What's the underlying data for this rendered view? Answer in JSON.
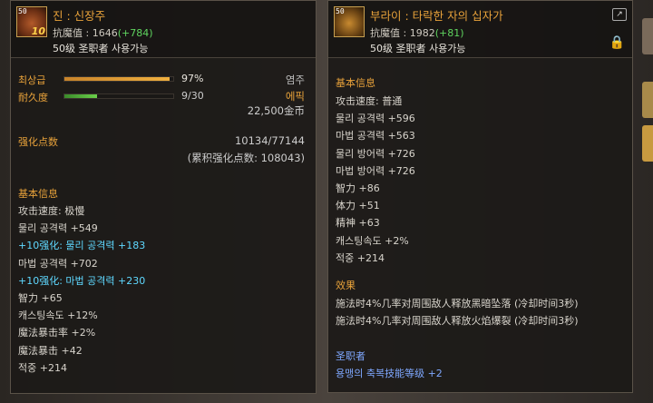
{
  "left": {
    "icon_level": "50",
    "icon_enhance": "10",
    "name": "진 : 신장주",
    "resist_label": "抗魔值 : 1646",
    "resist_bonus": "(+784)",
    "avail": "50级 圣职者 사용가능",
    "durability_max_label": "최상급",
    "durability_max_value": "97%",
    "durability_max_fraction": 0.97,
    "durability_label": "耐久度",
    "durability_value": "9/30",
    "durability_fraction": 0.3,
    "type_label": "염주",
    "rarity": "에픽",
    "price": "22,500金币",
    "enhance_label": "强化点数",
    "enhance_value": "10134/77144",
    "enhance_total": "(累积强化点数: 108043)",
    "basic_title": "基本信息",
    "stats": [
      {
        "text": "攻击速度:  极慢",
        "cls": ""
      },
      {
        "text": "물리 공격력 +549",
        "cls": ""
      },
      {
        "text": "+10强化:  물리 공격력 +183",
        "cls": "cyan"
      },
      {
        "text": "마법 공격력 +702",
        "cls": ""
      },
      {
        "text": "+10强化:  마법 공격력 +230",
        "cls": "cyan"
      },
      {
        "text": "智力 +65",
        "cls": ""
      },
      {
        "text": "캐스팅속도 +12%",
        "cls": ""
      },
      {
        "text": "魔法暴击率 +2%",
        "cls": ""
      },
      {
        "text": "魔法暴击 +42",
        "cls": ""
      },
      {
        "text": "적중 +214",
        "cls": ""
      }
    ]
  },
  "right": {
    "icon_level": "50",
    "name": "부라이 : 타락한 자의 십자가",
    "resist_label": "抗魔值 : 1982",
    "resist_bonus": "(+81)",
    "avail": "50级 圣职者 사용가능",
    "basic_title": "基本信息",
    "stats": [
      "攻击速度:  普通",
      "물리 공격력 +596",
      "마법 공격력 +563",
      "물리 방어력 +726",
      "마법 방어력 +726",
      "智力 +86",
      "体力 +51",
      "精神 +63",
      "캐스팅속도 +2%",
      "적중 +214"
    ],
    "effect_title": "效果",
    "effects": [
      "施法时4%几率对周围敌人释放黑暗坠落 (冷却时间3秒)",
      "施法时4%几率对周围敌人释放火焰爆裂 (冷却时间3秒)"
    ],
    "class_title": "圣职者",
    "class_skill": "용맹의 축복技能等级 +2"
  },
  "colors": {
    "accent": "#e8a23a",
    "cyan": "#5fd8ff",
    "green": "#5fd45f",
    "blue": "#7fa8ff"
  }
}
